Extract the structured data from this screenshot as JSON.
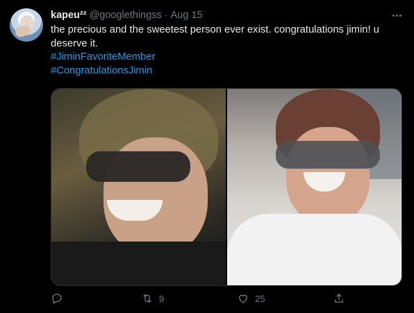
{
  "author": {
    "display_name": "kapeu²²",
    "handle": "@googlethingss",
    "separator": "·",
    "date": "Aug 15"
  },
  "tweet": {
    "text": "the precious and the sweetest person ever exist. congratulations jimin! u deserve it.",
    "hashtags": [
      "#JiminFavoriteMember",
      "#CongratulationsJimin"
    ]
  },
  "media": {
    "count": 2
  },
  "actions": {
    "reply_count": "",
    "retweet_count": "9",
    "like_count": "25",
    "share_count": ""
  },
  "icons": {
    "more": "more-horizontal-icon",
    "reply": "reply-icon",
    "retweet": "retweet-icon",
    "like": "heart-icon",
    "share": "share-icon"
  },
  "colors": {
    "background": "#000000",
    "text": "#e7e9ea",
    "muted": "#71767b",
    "link": "#1d9bf0"
  }
}
